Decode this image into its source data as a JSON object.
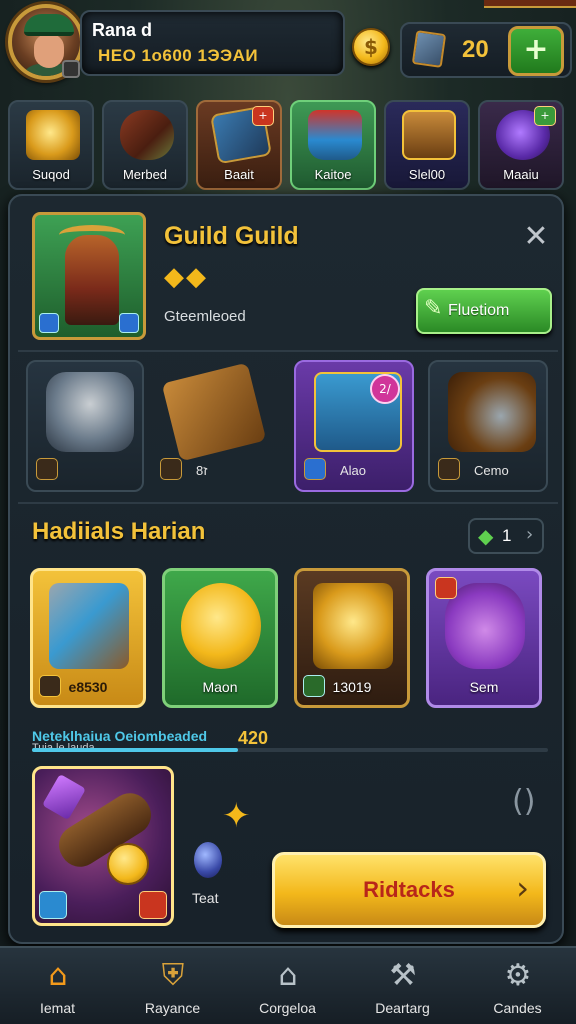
{
  "player": {
    "name": "Rana d",
    "subtitle": "HEO 1o600 1ЭЭАИ",
    "gem_count": "20",
    "coin_symbol": "$",
    "plus_symbol": "+"
  },
  "categories": [
    {
      "label": "Suqod",
      "badge": ""
    },
    {
      "label": "Merbed",
      "badge": ""
    },
    {
      "label": "Baait",
      "badge": "+"
    },
    {
      "label": "Kaitoe",
      "badge": "",
      "active": true
    },
    {
      "label": "Slel00",
      "badge": ""
    },
    {
      "label": "Maaiu",
      "badge": "+"
    }
  ],
  "guild": {
    "title": "Guild Guild",
    "stars": "◆◆",
    "status": "Gteemleoed",
    "close_symbol": "✕",
    "action_label": "Fluetiom",
    "action_icon": "✎"
  },
  "items": [
    {
      "label": ""
    },
    {
      "label": "8ז"
    },
    {
      "label": "Alao",
      "badge": "2/"
    },
    {
      "label": "Cemo"
    }
  ],
  "daily": {
    "title": "Hadiials Harian",
    "counter": "1",
    "counter_icon": "◆",
    "counter_arrow": "›",
    "rewards": [
      {
        "label": "e8530"
      },
      {
        "label": "Maon"
      },
      {
        "label": "13019"
      },
      {
        "label": "Sem"
      }
    ]
  },
  "progress": {
    "label_main": "Neteklhaiua Oeiombeaded",
    "label_sub": "Tuia le lauda",
    "value_text": "420",
    "fraction": 0.4
  },
  "bonus": {
    "item_label": "Teat",
    "bracket": "()",
    "claim_label": "Ridtacks",
    "claim_arrow": "›"
  },
  "nav": [
    {
      "label": "Iemat",
      "icon": "⌂",
      "active": true
    },
    {
      "label": "Rayance",
      "icon": "⛨"
    },
    {
      "label": "Corgeloa",
      "icon": "⌂"
    },
    {
      "label": "Deartarg",
      "icon": "⚒"
    },
    {
      "label": "Candes",
      "icon": "⚙"
    }
  ],
  "colors": {
    "accent_gold": "#f3c23a",
    "active_green": "#3f9a55",
    "cyan_text": "#4fc8e8",
    "claim_text": "#b8261a"
  }
}
